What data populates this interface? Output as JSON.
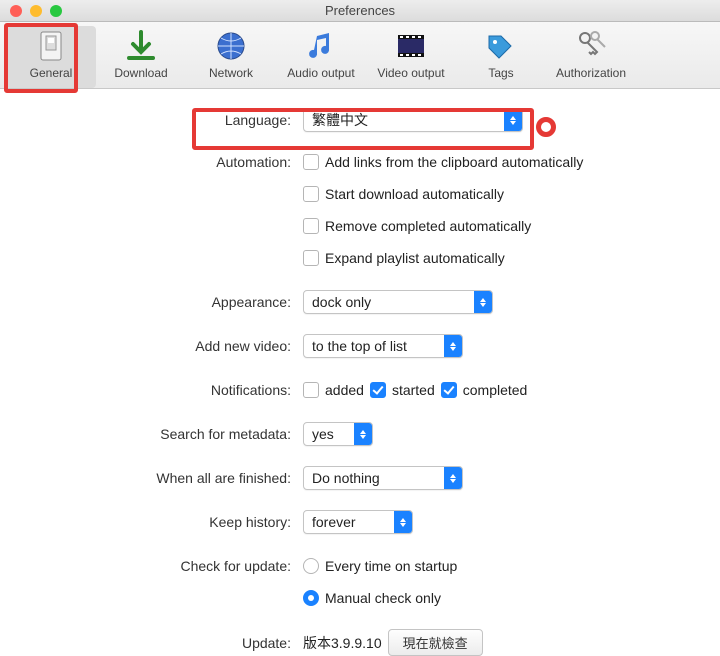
{
  "window": {
    "title": "Preferences"
  },
  "toolbar": {
    "items": [
      {
        "label": "General"
      },
      {
        "label": "Download"
      },
      {
        "label": "Network"
      },
      {
        "label": "Audio output"
      },
      {
        "label": "Video output"
      },
      {
        "label": "Tags"
      },
      {
        "label": "Authorization"
      }
    ]
  },
  "labels": {
    "language": "Language:",
    "automation": "Automation:",
    "appearance": "Appearance:",
    "addNewVideo": "Add new video:",
    "notifications": "Notifications:",
    "searchMetadata": "Search for metadata:",
    "whenFinished": "When all are finished:",
    "keepHistory": "Keep history:",
    "checkUpdate": "Check for update:",
    "update": "Update:"
  },
  "values": {
    "language": "繁體中文",
    "appearance": "dock only",
    "addNewVideo": "to the top of list",
    "searchMetadata": "yes",
    "whenFinished": "Do nothing",
    "keepHistory": "forever",
    "version": "版本3.9.9.10"
  },
  "automation": {
    "opt1": "Add links from the clipboard automatically",
    "opt2": "Start download automatically",
    "opt3": "Remove completed automatically",
    "opt4": "Expand playlist automatically"
  },
  "notifications": {
    "added": "added",
    "started": "started",
    "completed": "completed"
  },
  "checkUpdate": {
    "everyTime": "Every time on startup",
    "manual": "Manual check only"
  },
  "buttons": {
    "checkNow": "現在就檢查"
  }
}
